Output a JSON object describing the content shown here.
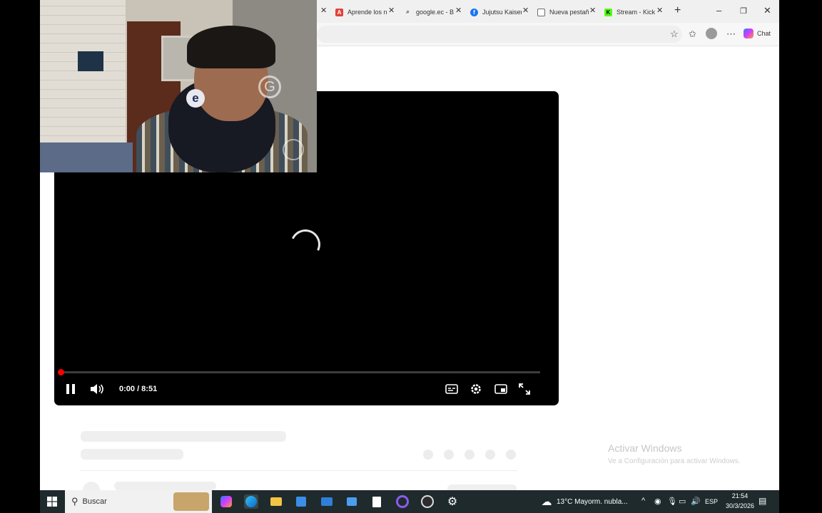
{
  "browser": {
    "tabs": [
      {
        "label": "Aprende los n",
        "icon": "A",
        "color": "#e2413b"
      },
      {
        "label": "google.ec - B",
        "icon": "search",
        "color": "#4b4b4b"
      },
      {
        "label": "Jujutsu Kaisen",
        "icon": "f",
        "color": "#1877f2"
      },
      {
        "label": "Nueva pestañ",
        "icon": "page",
        "color": "#6d6d6d"
      },
      {
        "label": "Stream - Kick",
        "icon": "K",
        "color": "#53fc18"
      }
    ],
    "new_tab": "+",
    "chat_label": "Chat"
  },
  "player": {
    "time": "0:00 / 8:51",
    "progress": 0.0
  },
  "watermark": {
    "title": "Activar Windows",
    "subtitle": "Ve a Configuración para activar Windows."
  },
  "taskbar": {
    "search_label": "Buscar",
    "weather": "13°C  Mayorm. nubla...",
    "language": "ESP",
    "time": "21:54",
    "date": "30/3/2026"
  }
}
